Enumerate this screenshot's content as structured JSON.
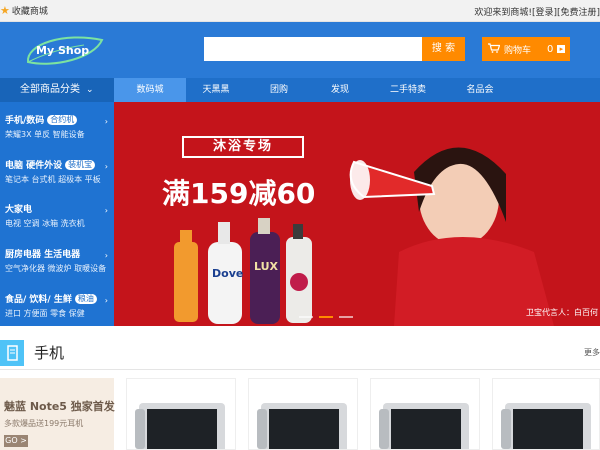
{
  "topbar": {
    "favorite_label": "收藏商城",
    "welcome_text": "欢迎来到商城!",
    "login_link": "[登录]",
    "register_link": "[免费注册]"
  },
  "header": {
    "logo_text": "My Shop",
    "search": {
      "value": "",
      "placeholder": "",
      "button_label": "搜 索"
    },
    "cart": {
      "label": "购物车",
      "count": "0"
    }
  },
  "nav": {
    "all_categories": "全部商品分类",
    "tabs": [
      {
        "label": "数码城",
        "active": true
      },
      {
        "label": "天黑黑",
        "active": false
      },
      {
        "label": "团购",
        "active": false
      },
      {
        "label": "发现",
        "active": false
      },
      {
        "label": "二手特卖",
        "active": false
      },
      {
        "label": "名品会",
        "active": false
      }
    ]
  },
  "sidebar": {
    "categories": [
      {
        "title": "手机/数码",
        "tag": "合约机",
        "sub": "荣耀3X 单反 智能设备"
      },
      {
        "title": "电脑 硬件外设",
        "tag": "装机宝",
        "sub": "笔记本 台式机 超极本 平板"
      },
      {
        "title": "大家电",
        "tag": "",
        "sub": "电视 空调 冰箱 洗衣机"
      },
      {
        "title": "厨房电器 生活电器",
        "tag": "",
        "sub": "空气净化器 微波炉 取暖设备"
      },
      {
        "title": "食品/ 饮料/ 生鲜",
        "tag": "粮油",
        "sub": "进口 方便面 零食 保健"
      }
    ]
  },
  "banner": {
    "headline": "沐浴专场",
    "promo": "满159减60",
    "spokesperson": "卫宝代言人：白百何",
    "brand_label": "LUX",
    "brand_label_2": "Dove"
  },
  "section": {
    "title": "手机",
    "more": "更多"
  },
  "promo_card": {
    "title": "魅蓝 Note5 独家首发",
    "subtitle": "多款爆品送199元耳机",
    "button": "GO >"
  },
  "colors": {
    "primary": "#2a7ad6",
    "accent": "#ff8a00",
    "banner_red": "#c4141b"
  }
}
